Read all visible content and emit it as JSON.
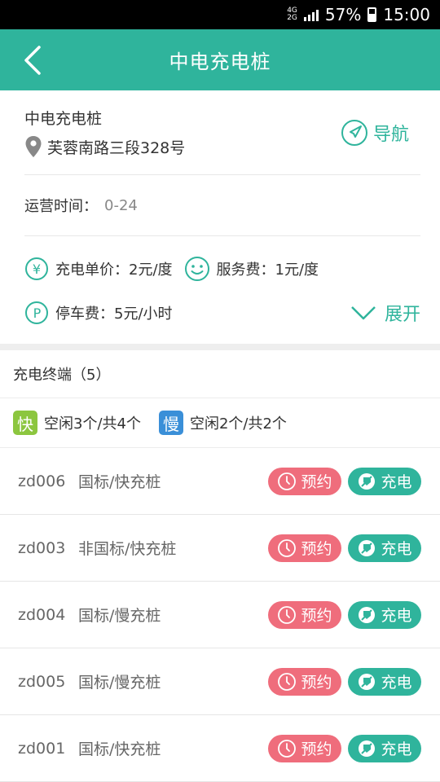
{
  "status_bar": {
    "network_top": "4G",
    "network_bottom": "2G",
    "battery": "57%",
    "time": "15:00"
  },
  "header": {
    "title": "中电充电桩"
  },
  "station": {
    "name": "中电充电桩",
    "address": "芙蓉南路三段328号",
    "nav_label": "导航"
  },
  "hours": {
    "label": "运营时间：",
    "value": "0-24"
  },
  "prices": {
    "charge_label": "充电单价：",
    "charge_value": "2元/度",
    "service_label": "服务费：",
    "service_value": "1元/度",
    "parking_label": "停车费：",
    "parking_value": "5元/小时",
    "expand_label": "展开"
  },
  "terminals": {
    "header": "充电终端（5）",
    "fast_badge": "快",
    "fast_text": "空闲3个/共4个",
    "slow_badge": "慢",
    "slow_text": "空闲2个/共2个",
    "reserve_label": "预约",
    "charge_label": "充电",
    "items": [
      {
        "code": "zd006",
        "type": "国标/快充桩"
      },
      {
        "code": "zd003",
        "type": "非国标/快充桩"
      },
      {
        "code": "zd004",
        "type": "国标/慢充桩"
      },
      {
        "code": "zd005",
        "type": "国标/慢充桩"
      },
      {
        "code": "zd001",
        "type": "国标/快充桩"
      }
    ]
  },
  "colors": {
    "accent": "#2fb49c",
    "reserve": "#ef6d7c",
    "fast": "#8cc63f",
    "slow": "#3a8fd8"
  }
}
